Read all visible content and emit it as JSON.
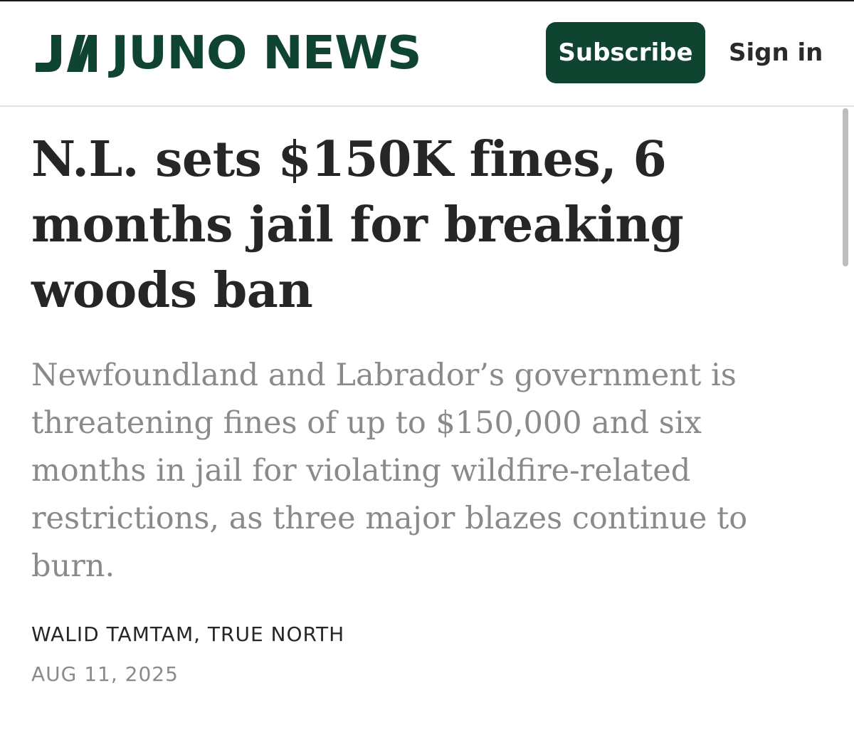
{
  "brand": {
    "logo_mark": "JN",
    "name": "JUNO NEWS",
    "color": "#0f4430"
  },
  "header": {
    "subscribe_label": "Subscribe",
    "signin_label": "Sign in"
  },
  "article": {
    "headline": "N.L. sets $150K fines, 6 months jail for breaking woods ban",
    "dek": "Newfoundland and Labrador’s government is threatening fines of up to $150,000 and six months in jail for violating wildfire-related restrictions, as three major blazes continue to burn.",
    "byline": "WALID TAMTAM, TRUE NORTH",
    "date": "AUG 11, 2025"
  }
}
